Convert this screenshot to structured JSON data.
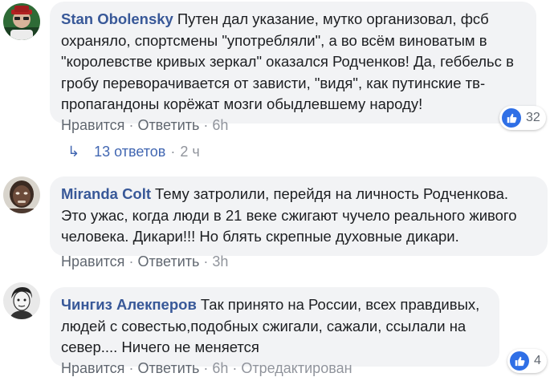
{
  "comments": [
    {
      "author": "Stan Obolensky",
      "text": "Путен дал указание, мутко организовал, фсб охраняло, спортсмены \"употребляли\", а во всём виноватым в \"королевстве кривых зеркал\" оказался Родченков! Да, геббельс в гробу переворачивается от зависти, \"видя\", как путинские тв-пропагандоны корёжат мозги обыдлевшему народу!",
      "like_label": "Нравится",
      "reply_label": "Ответить",
      "time": "6h",
      "reactions_count": "32",
      "separator": "·"
    },
    {
      "author": "Miranda Colt",
      "text": "Тему затролили, перейдя на личность Родченкова. Это ужас, когда люди в 21 веке сжигают чучело реального живого человека. Дикари!!! Но блять скрепные духовные дикари.",
      "like_label": "Нравится",
      "reply_label": "Ответить",
      "time": "3h",
      "separator": "·"
    },
    {
      "author": "Чингиз Алекперов",
      "text": "Так принято на России, всех правдивых, людей с совестью,подобных сжигали, сажали, ссылали на север.... Ничего не меняется",
      "like_label": "Нравится",
      "reply_label": "Ответить",
      "time": "6h",
      "edited_label": "Отредактирован",
      "reactions_count": "4",
      "separator": "·"
    }
  ],
  "replies": {
    "arrow": "↳",
    "count_label": "13 ответов",
    "time": "2 ч",
    "separator": "·"
  },
  "colors": {
    "author": "#385898",
    "bubble": "#f2f3f5",
    "link": "#606770",
    "meta": "#90949c",
    "like_badge": "#2f6fe6"
  }
}
